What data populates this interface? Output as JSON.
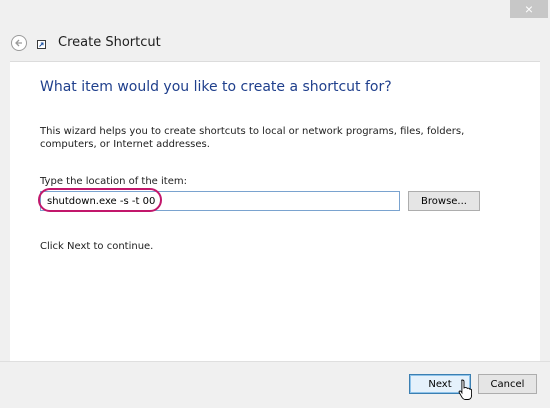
{
  "window": {
    "close_glyph": "×",
    "title": "Create Shortcut"
  },
  "page": {
    "heading": "What item would you like to create a shortcut for?",
    "description": "This wizard helps you to create shortcuts to local or network programs, files, folders, computers, or Internet addresses.",
    "location_label": "Type the location of the item:",
    "location_value": "shutdown.exe -s -t 00",
    "browse_label": "Browse...",
    "continue_text": "Click Next to continue."
  },
  "footer": {
    "next_label": "Next",
    "cancel_label": "Cancel"
  },
  "icons": [
    "close-icon",
    "back-arrow-icon",
    "shortcut-icon",
    "mouse-cursor-icon"
  ],
  "colors": {
    "heading": "#1f3f8c",
    "highlight_ring": "#c2176b",
    "input_border": "#7aa3cf"
  }
}
